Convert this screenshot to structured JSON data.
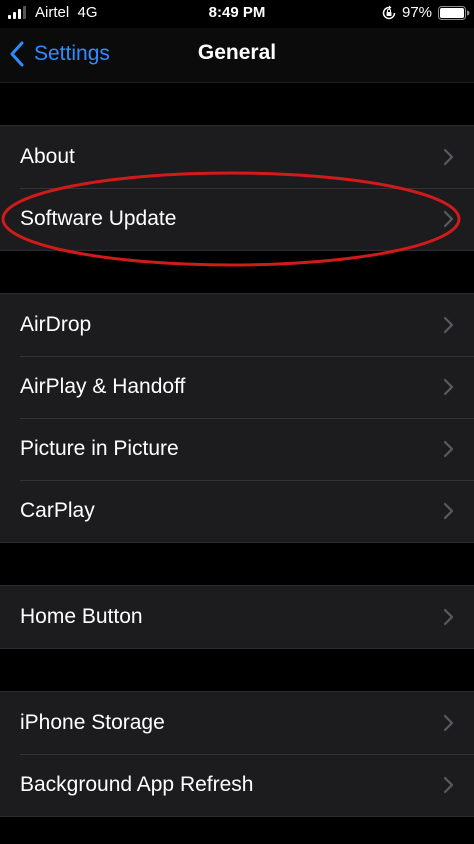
{
  "status_bar": {
    "carrier": "Airtel",
    "network": "4G",
    "time": "8:49 PM",
    "battery_percent": "97%",
    "icons": [
      "signal-bars-icon",
      "orientation-lock-icon",
      "battery-icon"
    ]
  },
  "nav": {
    "back_label": "Settings",
    "title": "General"
  },
  "groups": [
    {
      "items": [
        {
          "label": "About"
        },
        {
          "label": "Software Update"
        }
      ]
    },
    {
      "items": [
        {
          "label": "AirDrop"
        },
        {
          "label": "AirPlay & Handoff"
        },
        {
          "label": "Picture in Picture"
        },
        {
          "label": "CarPlay"
        }
      ]
    },
    {
      "items": [
        {
          "label": "Home Button"
        }
      ]
    },
    {
      "items": [
        {
          "label": "iPhone Storage"
        },
        {
          "label": "Background App Refresh"
        }
      ]
    }
  ],
  "annotation": {
    "highlighted_item": "Software Update",
    "color": "#d11a1a"
  },
  "colors": {
    "background": "#000000",
    "group_background": "#1c1c1e",
    "accent": "#2f8cff",
    "chevron": "#5a5a5e"
  }
}
